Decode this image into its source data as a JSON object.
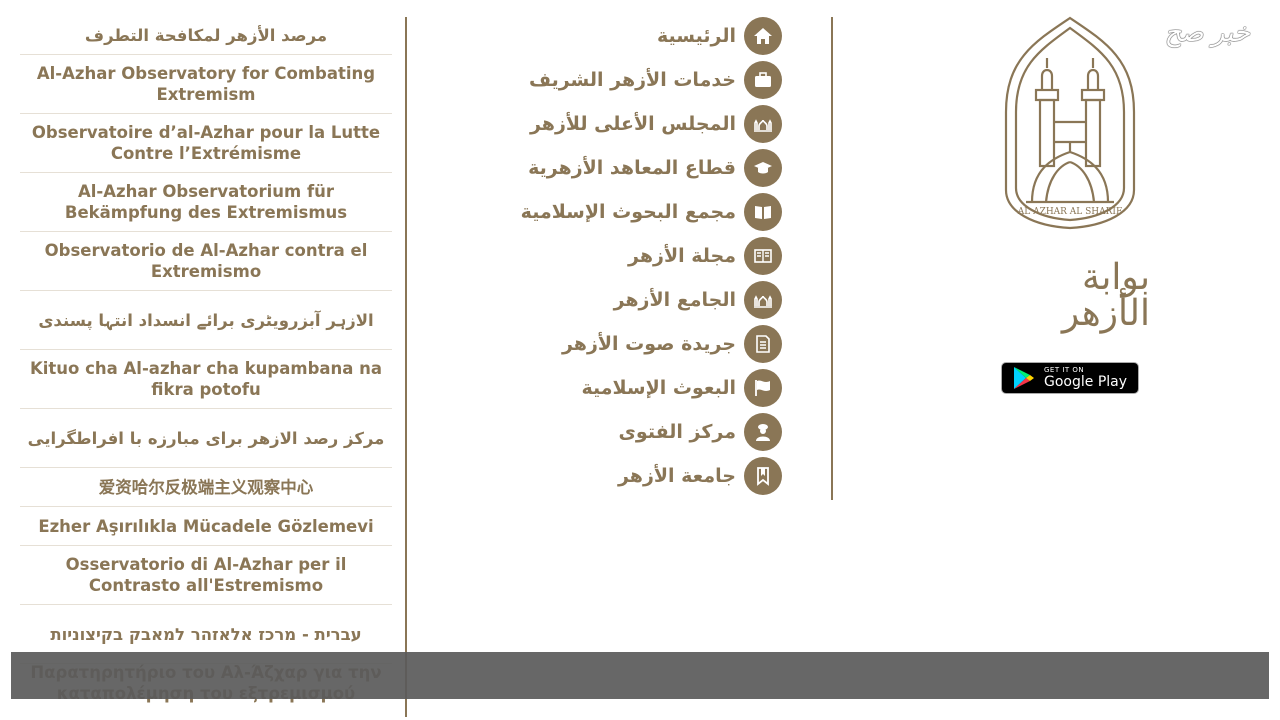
{
  "watermark": "خبر صح",
  "logo": {
    "emblem_text": "AL AZHAR AL SHARIF",
    "portal_name": "بوابة الأزهر",
    "google_play": {
      "small": "GET IT ON",
      "big": "Google Play"
    }
  },
  "menu": [
    {
      "label": "الرئيسية",
      "icon": "home-icon"
    },
    {
      "label": "خدمات الأزهر الشريف",
      "icon": "briefcase-icon"
    },
    {
      "label": "المجلس الأعلى للأزهر",
      "icon": "mosque-icon"
    },
    {
      "label": "قطاع المعاهد الأزهرية",
      "icon": "graduation-cap-icon"
    },
    {
      "label": "مجمع البحوث الإسلامية",
      "icon": "open-book-icon"
    },
    {
      "label": "مجلة الأزهر",
      "icon": "magazine-icon"
    },
    {
      "label": "الجامع الأزهر",
      "icon": "mosque-icon"
    },
    {
      "label": "جريدة صوت الأزهر",
      "icon": "newspaper-icon"
    },
    {
      "label": "البعوث الإسلامية",
      "icon": "flag-icon"
    },
    {
      "label": "مركز الفتوى",
      "icon": "scholar-icon"
    },
    {
      "label": "جامعة الأزهر",
      "icon": "bookmark-icon"
    }
  ],
  "languages": [
    {
      "label": "مرصد الأزهر لمكافحة التطرف",
      "rtl": true,
      "lines": 1
    },
    {
      "label": "Al-Azhar Observatory for Combating Extremism",
      "rtl": false,
      "lines": 2
    },
    {
      "label": "Observatoire d’al-Azhar pour la Lutte Contre l’Extrémisme",
      "rtl": false,
      "lines": 2
    },
    {
      "label": "Al-Azhar Observatorium für Bekämpfung des Extremismus",
      "rtl": false,
      "lines": 2
    },
    {
      "label": "Observatorio de Al-Azhar contra el Extremismo",
      "rtl": false,
      "lines": 2
    },
    {
      "label": "الازہر آبزرویٹری برائے انسداد انتہا پسندی",
      "rtl": true,
      "lines": 2
    },
    {
      "label": "Kituo cha Al-azhar cha kupambana na fikra potofu",
      "rtl": false,
      "lines": 2
    },
    {
      "label": "مرکز رصد الازهر برای مبارزه با افراطگرایی",
      "rtl": true,
      "lines": 2
    },
    {
      "label": "爱资哈尔反极端主义观察中心",
      "rtl": false,
      "lines": 1
    },
    {
      "label": "Ezher Aşırılıkla Mücadele Gözlemevi",
      "rtl": false,
      "lines": 1
    },
    {
      "label": "Osservatorio di Al-Azhar per il Contrasto all'Estremismo",
      "rtl": false,
      "lines": 2
    },
    {
      "label": "עברית - מרכז אלאזהר למאבק בקיצוניות",
      "rtl": true,
      "lines": 2
    }
  ],
  "overlay_language": "Παρατηρητήριο του Αλ-Άζχαρ για την καταπολέμηση του εξτρεμισμού",
  "colors": {
    "accent": "#8a7656",
    "overlay": "#5a5a5a"
  }
}
